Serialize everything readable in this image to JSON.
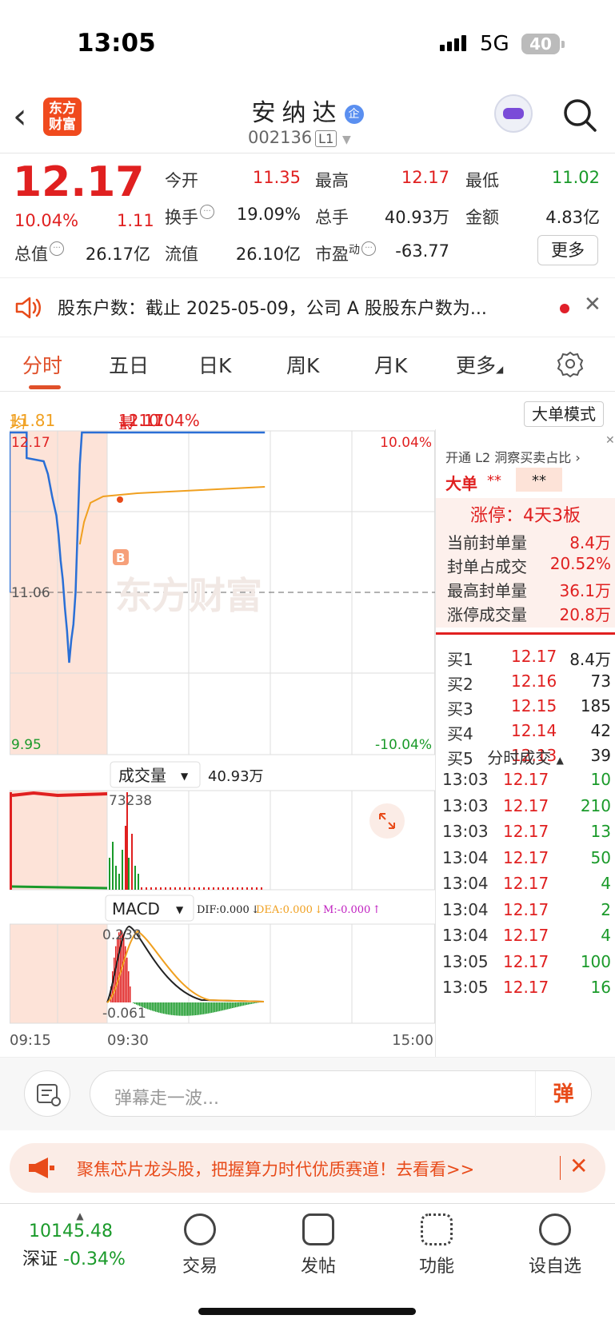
{
  "status_bar": {
    "time": "13:05",
    "network": "5G",
    "battery": "40"
  },
  "header": {
    "stock_name": "安纳达",
    "name_badge": "企",
    "stock_code": "002136",
    "level_badge": "L1",
    "logo_text_1": "东方",
    "logo_text_2": "财富"
  },
  "quote": {
    "price": "12.17",
    "change_pct": "10.04%",
    "change_amt": "1.11",
    "open_label": "今开",
    "open_value": "11.35",
    "high_label": "最高",
    "high_value": "12.17",
    "low_label": "最低",
    "low_value": "11.02",
    "turnover_label": "换手",
    "turnover_value": "19.09%",
    "volume_label": "总手",
    "volume_value": "40.93万",
    "amount_label": "金额",
    "amount_value": "4.83亿",
    "mktcap_label": "总值",
    "mktcap_value": "26.17亿",
    "float_label": "流值",
    "float_value": "26.10亿",
    "pe_label": "市盈",
    "pe_sup": "动",
    "pe_value": "-63.77",
    "more_label": "更多"
  },
  "notice": {
    "text": "股东户数：截止 2025-05-09，公司 A 股股东户数为..."
  },
  "tabs": [
    "分时",
    "五日",
    "日K",
    "周K",
    "月K",
    "更多"
  ],
  "info_row": {
    "avg_label": "均价：",
    "avg_value": "11.81",
    "latest_label": "最新：",
    "latest_value": "12.17",
    "latest_change": "1.11",
    "latest_pct": "10.04%",
    "big_order_mode": "大单模式"
  },
  "chart": {
    "price_max": "12.17",
    "price_min": "9.95",
    "price_ref": "11.06",
    "pct_max": "10.04%",
    "pct_min": "-10.04%",
    "watermark": "东方财富",
    "buy_marker": "B",
    "volume_label": "成交量",
    "volume_total": "40.93万",
    "volume_max": "73238",
    "macd_label": "MACD",
    "dif": "DIF:0.000",
    "dea": "DEA:0.000",
    "m": "M:-0.000",
    "macd_max": "0.238",
    "macd_min": "-0.061",
    "time_start": "09:15",
    "time_open": "09:30",
    "time_end": "15:00",
    "price_path": [
      [
        0,
        0.0
      ],
      [
        0.04,
        0.0
      ],
      [
        0.04,
        0.08
      ],
      [
        0.08,
        0.09
      ],
      [
        0.09,
        0.13
      ],
      [
        0.1,
        0.2
      ],
      [
        0.11,
        0.26
      ],
      [
        0.115,
        0.32
      ],
      [
        0.12,
        0.4
      ],
      [
        0.125,
        0.46
      ],
      [
        0.13,
        0.55
      ],
      [
        0.135,
        0.62
      ],
      [
        0.14,
        0.72
      ],
      [
        0.145,
        0.65
      ],
      [
        0.15,
        0.6
      ],
      [
        0.155,
        0.5
      ],
      [
        0.16,
        0.3
      ],
      [
        0.165,
        0.1
      ],
      [
        0.17,
        0.0
      ],
      [
        0.6,
        0.0
      ]
    ],
    "avg_path": [
      [
        0.165,
        0.35
      ],
      [
        0.175,
        0.28
      ],
      [
        0.19,
        0.22
      ],
      [
        0.22,
        0.2
      ],
      [
        0.3,
        0.19
      ],
      [
        0.45,
        0.18
      ],
      [
        0.6,
        0.17
      ]
    ]
  },
  "order_panel": {
    "l2_label": "开通 L2 洞察买卖占比",
    "big_label": "大单",
    "big_val1": "**",
    "big_val2": "**",
    "limit_up_label": "涨停：4天3板",
    "stats": [
      {
        "label": "当前封单量",
        "value": "8.4万"
      },
      {
        "label": "封单占成交",
        "value": "20.52%"
      },
      {
        "label": "最高封单量",
        "value": "36.1万"
      },
      {
        "label": "涨停成交量",
        "value": "20.8万"
      }
    ],
    "bids": [
      {
        "label": "买1",
        "price": "12.17",
        "vol": "8.4万"
      },
      {
        "label": "买2",
        "price": "12.16",
        "vol": "73"
      },
      {
        "label": "买3",
        "price": "12.15",
        "vol": "185"
      },
      {
        "label": "买4",
        "price": "12.14",
        "vol": "42"
      },
      {
        "label": "买5",
        "price": "12.13",
        "vol": "39"
      }
    ],
    "ticks_label": "分时成交",
    "ticks": [
      {
        "time": "13:03",
        "price": "12.17",
        "vol": "10"
      },
      {
        "time": "13:03",
        "price": "12.17",
        "vol": "210"
      },
      {
        "time": "13:03",
        "price": "12.17",
        "vol": "13"
      },
      {
        "time": "13:04",
        "price": "12.17",
        "vol": "50"
      },
      {
        "time": "13:04",
        "price": "12.17",
        "vol": "4"
      },
      {
        "time": "13:04",
        "price": "12.17",
        "vol": "2"
      },
      {
        "time": "13:04",
        "price": "12.17",
        "vol": "4"
      },
      {
        "time": "13:05",
        "price": "12.17",
        "vol": "100"
      },
      {
        "time": "13:05",
        "price": "12.17",
        "vol": "16"
      }
    ]
  },
  "comment": {
    "placeholder": "弹幕走一波...",
    "danmu": "弹"
  },
  "promo": {
    "text": "聚焦芯片龙头股，把握算力时代优质赛道！去看看>>"
  },
  "bottom_nav": {
    "index_value": "10145.48",
    "index_name": "深证",
    "index_pct": "-0.34%",
    "items": [
      "交易",
      "发帖",
      "功能",
      "设自选"
    ]
  },
  "colors": {
    "up": "#e02020",
    "down": "#1a9a2a",
    "accent": "#e0502a",
    "avg_line": "#f0a020",
    "price_line": "#2a6fd6"
  }
}
